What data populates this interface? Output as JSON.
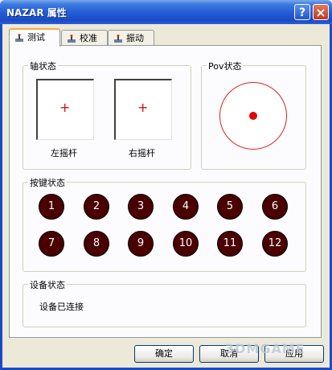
{
  "window": {
    "title": "NAZAR 属性"
  },
  "titlebar": {
    "help_label": "?",
    "close_label": "×"
  },
  "tabs": [
    {
      "label": "测试",
      "icon": "joystick-icon",
      "active": true
    },
    {
      "label": "校准",
      "icon": "joystick-icon",
      "active": false
    },
    {
      "label": "振动",
      "icon": "joystick-icon",
      "active": false
    }
  ],
  "axis_group": {
    "title": "轴状态",
    "left_label": "左摇杆",
    "right_label": "右摇杆",
    "crosshair": "+"
  },
  "pov_group": {
    "title": "Pov状态"
  },
  "buttons_group": {
    "title": "按键状态",
    "buttons": [
      "1",
      "2",
      "3",
      "4",
      "5",
      "6",
      "7",
      "8",
      "9",
      "10",
      "11",
      "12"
    ]
  },
  "device_group": {
    "title": "设备状态",
    "status": "设备已连接"
  },
  "footer": {
    "ok_label": "确定",
    "cancel_label": "取消",
    "apply_label": "应用"
  },
  "watermark": "3DMGAME",
  "colors": {
    "button_fill": "#4a0000",
    "pov_dot": "#e00000",
    "crosshair": "#d01010"
  }
}
